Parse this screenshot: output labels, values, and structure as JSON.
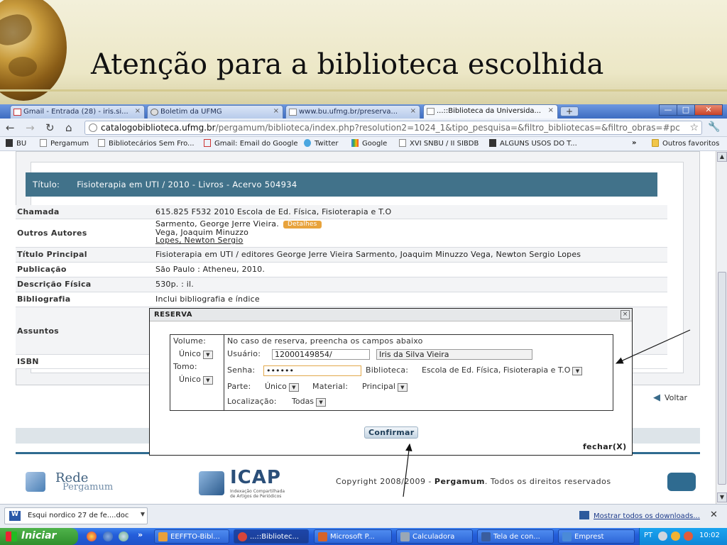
{
  "slide": {
    "title": "Atenção para a biblioteca escolhida"
  },
  "browser": {
    "tabs": [
      {
        "label": "Gmail - Entrada (28) - iris.si...",
        "close": "×"
      },
      {
        "label": "Boletim da UFMG",
        "close": "×"
      },
      {
        "label": "www.bu.ufmg.br/preserva...",
        "close": "×"
      },
      {
        "label": "...::Biblioteca da Universida...",
        "close": "×"
      }
    ],
    "new_tab": "+",
    "window_buttons": [
      "—",
      "□",
      "✕"
    ],
    "address": {
      "host": "catalogobiblioteca.ufmg.br",
      "path": "/pergamum/biblioteca/index.php?resolution2=1024_1&tipo_pesquisa=&filtro_bibliotecas=&filtro_obras=#pc"
    },
    "nav": {
      "back": "←",
      "forward": "→",
      "reload": "↻",
      "home": "⌂",
      "star": "☆",
      "wrench": "🔧"
    },
    "bookmarks": [
      {
        "label": "BU"
      },
      {
        "label": "Pergamum"
      },
      {
        "label": "Bibliotecários Sem Fro..."
      },
      {
        "label": "Gmail: Email do Google"
      },
      {
        "label": "Twitter"
      },
      {
        "label": "Google"
      },
      {
        "label": "XVI SNBU / II SIBDB"
      },
      {
        "label": "ALGUNS USOS DO T..."
      }
    ],
    "bookmarks_more": "»",
    "other_bookmarks": "Outros favoritos"
  },
  "record": {
    "title_label": "Título:",
    "title_value": "Fisioterapia em UTI / 2010 - Livros - Acervo 504934",
    "rows": [
      {
        "key": "Chamada",
        "value": "615.825 F532 2010 Escola de Ed. Física, Fisioterapia e T.O"
      },
      {
        "key": "Outros Autores",
        "authors": [
          "Sarmento, George Jerre Vieira.",
          "Vega, Joaquim Minuzzo",
          "Lopes, Newton Sergio"
        ],
        "details": "Detalhes"
      },
      {
        "key": "Título Principal",
        "value": "Fisioterapia em UTI / editores George Jerre Vieira Sarmento, Joaquim Minuzzo Vega, Newton Sergio Lopes"
      },
      {
        "key": "Publicação",
        "value": "São Paulo : Atheneu, 2010."
      },
      {
        "key": "Descrição Física",
        "value": "530p. : il."
      },
      {
        "key": "Bibliografia",
        "value": "Inclui bibliografia e índice"
      },
      {
        "key": "Assuntos",
        "value": ""
      },
      {
        "key": "ISBN",
        "value": ""
      }
    ],
    "voltar": "Voltar"
  },
  "modal": {
    "title": "RESERVA",
    "close": "×",
    "volume_label": "Volume:",
    "volume_value": "Único",
    "tomo_label": "Tomo:",
    "tomo_value": "Único",
    "instruction": "No caso de reserva, preencha os campos abaixo",
    "usuario_label": "Usuário:",
    "usuario_value": "12000149854/",
    "user_name": "Iris da Silva Vieira",
    "senha_label": "Senha:",
    "senha_value": "••••••",
    "biblioteca_label": "Biblioteca:",
    "biblioteca_value": "Escola de Ed. Física, Fisioterapia e T.O",
    "parte_label": "Parte:",
    "parte_value": "Único",
    "material_label": "Material:",
    "material_value": "Principal",
    "localizacao_label": "Localização:",
    "localizacao_value": "Todas",
    "confirm": "Confirmar",
    "fechar": "fechar(X)"
  },
  "footer": {
    "rede_1": "Rede",
    "rede_2": "Pergamum",
    "icap": "ICAP",
    "icap_sub": "Indexação Compartilhada de Artigos de Periódicos",
    "copyright_pre": "Copyright 2008/2009 - ",
    "copyright_brand": "Pergamum",
    "copyright_post": ". Todos os direitos reservados"
  },
  "downloads": {
    "item": "Esqui nordico  27 de fe....doc",
    "item_icon": "W",
    "show_all": "Mostrar todos os downloads...",
    "close": "✕"
  },
  "taskbar": {
    "start": "Iniciar",
    "more": "»",
    "buttons": [
      {
        "label": "EEFFTO-Bibl...",
        "color": "#e8a03a"
      },
      {
        "label": "...::Bibliotec...",
        "color": "#d7453a"
      },
      {
        "label": "Microsoft P...",
        "color": "#d4632a"
      },
      {
        "label": "Calculadora",
        "color": "#9aa7b5"
      },
      {
        "label": "Tela de con...",
        "color": "#3a5d9e"
      },
      {
        "label": "Emprest",
        "color": "#4a8ad8"
      }
    ],
    "lang": "PT",
    "clock": "10:02"
  }
}
